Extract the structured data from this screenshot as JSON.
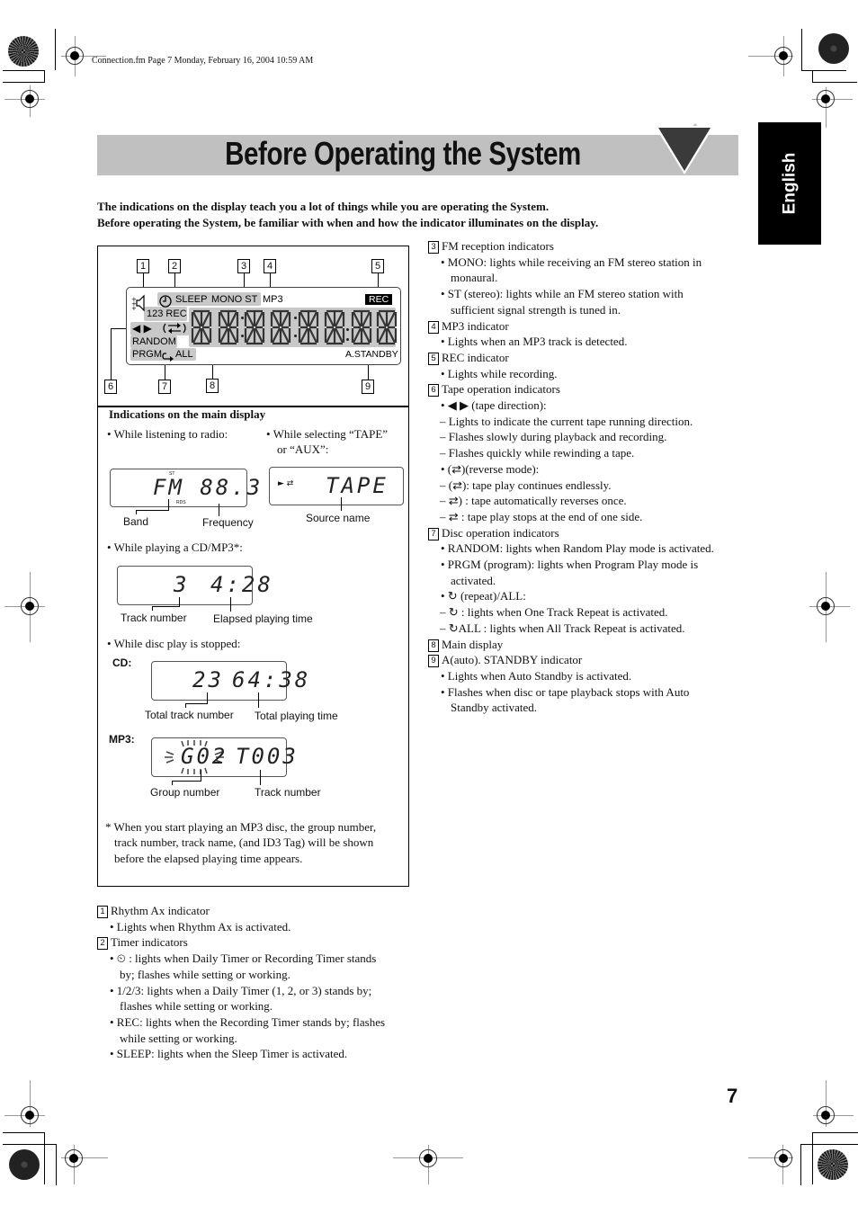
{
  "header": {
    "file_info": "Connection.fm  Page 7  Monday, February 16, 2004  10:59 AM"
  },
  "title": "Before Operating the System",
  "language_tab": "English",
  "intro": [
    "The indications on the display teach you a lot of things while you are operating the System.",
    "Before operating the System, be familiar with when and how the indicator illuminates on the display."
  ],
  "display_diagram": {
    "callouts": [
      "1",
      "2",
      "3",
      "4",
      "5",
      "6",
      "7",
      "8",
      "9"
    ],
    "labels": {
      "sleep": "SLEEP",
      "mono_st": "MONO ST",
      "mp3": "MP3",
      "rec": "REC",
      "timer_rec": "123 REC",
      "tape_dir": "◀ ▶",
      "random": "RANDOM",
      "prgm_all": "PRGM",
      "all": "ALL",
      "standby": "A.STANDBY"
    },
    "icons": [
      "rhythm-ax-icon",
      "timer-clock-icon",
      "tape-reverse-icon",
      "repeat-icon"
    ]
  },
  "main_display": {
    "heading": "Indications on the main display",
    "radio": {
      "bullet": "• While listening to radio:",
      "st": "ST",
      "rds": "RDS",
      "readout": "FM  88.3",
      "caption_band": "Band",
      "caption_freq": "Frequency"
    },
    "tape": {
      "bullet_line1": "• While selecting “TAPE”",
      "bullet_line2": "or “AUX”:",
      "indicator": "► ⇄",
      "readout": "TAPE",
      "caption": "Source name"
    },
    "cd_play": {
      "bullet": "• While playing a CD/MP3*:",
      "track": "3",
      "time": "4:28",
      "caption_track": "Track number",
      "caption_time": "Elapsed playing time"
    },
    "stopped": {
      "bullet": "• While disc play is stopped:",
      "cd_label": "CD:",
      "cd_tracks": "23",
      "cd_time": "64:38",
      "caption_total_tracks": "Total track number",
      "caption_total_time": "Total playing time",
      "mp3_label": "MP3:",
      "mp3_group": "G02",
      "mp3_track": "T003",
      "caption_group": "Group number",
      "caption_track": "Track number"
    },
    "footnote": [
      "* When you start playing an MP3 disc, the group number,",
      "track number, track name, (and ID3 Tag) will be shown",
      "before the elapsed playing time appears."
    ]
  },
  "left_list": [
    {
      "type": "head",
      "num": "1",
      "text": "Rhythm Ax indicator"
    },
    {
      "type": "b1",
      "text": "• Lights when Rhythm Ax is activated."
    },
    {
      "type": "head",
      "num": "2",
      "text": "Timer indicators"
    },
    {
      "type": "b1",
      "text": "•  ⏲ : lights when Daily Timer or Recording Timer stands"
    },
    {
      "type": "b1c",
      "text": "by; flashes while setting or working."
    },
    {
      "type": "b1",
      "text": "• 1/2/3: lights when a Daily Timer (1, 2, or 3) stands by;"
    },
    {
      "type": "b1c",
      "text": "flashes while setting or working."
    },
    {
      "type": "b1",
      "text": "• REC: lights when the Recording Timer stands by; flashes"
    },
    {
      "type": "b1c",
      "text": "while setting or working."
    },
    {
      "type": "b1",
      "text": "• SLEEP: lights when the Sleep Timer is activated."
    }
  ],
  "right_list": [
    {
      "type": "head",
      "num": "3",
      "text": "FM reception indicators"
    },
    {
      "type": "b1",
      "text": "• MONO: lights while receiving an FM stereo station in"
    },
    {
      "type": "b1c",
      "text": "monaural."
    },
    {
      "type": "b1",
      "text": "• ST (stereo): lights while an FM stereo station with"
    },
    {
      "type": "b1c",
      "text": "sufficient signal strength is tuned in."
    },
    {
      "type": "head",
      "num": "4",
      "text": "MP3 indicator"
    },
    {
      "type": "b1",
      "text": "• Lights when an MP3 track is detected."
    },
    {
      "type": "head",
      "num": "5",
      "text": "REC indicator"
    },
    {
      "type": "b1",
      "text": "• Lights while recording."
    },
    {
      "type": "head",
      "num": "6",
      "text": "Tape operation indicators"
    },
    {
      "type": "b1",
      "text": "• ◀ ▶ (tape direction):"
    },
    {
      "type": "b2",
      "text": "– Lights to indicate the current tape running direction."
    },
    {
      "type": "b2",
      "text": "– Flashes slowly during playback and recording."
    },
    {
      "type": "b2",
      "text": "– Flashes quickly while rewinding a tape."
    },
    {
      "type": "b1",
      "text": "• (⇄)(reverse mode):"
    },
    {
      "type": "b2",
      "text": "– (⇄): tape play continues endlessly."
    },
    {
      "type": "b2",
      "text": "–  ⇄)  : tape automatically reverses once."
    },
    {
      "type": "b2",
      "text": "–   ⇄   : tape play stops at the end of one side."
    },
    {
      "type": "head",
      "num": "7",
      "text": "Disc operation indicators"
    },
    {
      "type": "b1",
      "text": "• RANDOM: lights when Random Play mode is activated."
    },
    {
      "type": "b1",
      "text": "• PRGM (program): lights when Program Play mode is"
    },
    {
      "type": "b1c",
      "text": "activated."
    },
    {
      "type": "b1",
      "text": "• ↻ (repeat)/ALL:"
    },
    {
      "type": "b2",
      "text": "– ↻ : lights when One Track Repeat is activated."
    },
    {
      "type": "b2",
      "text": "– ↻ALL : lights when All Track Repeat is activated."
    },
    {
      "type": "head",
      "num": "8",
      "text": "Main display"
    },
    {
      "type": "head",
      "num": "9",
      "text": "A(auto). STANDBY indicator"
    },
    {
      "type": "b1",
      "text": "• Lights when Auto Standby is activated."
    },
    {
      "type": "b1",
      "text": "• Flashes when disc or tape playback stops with Auto"
    },
    {
      "type": "b1c",
      "text": "Standby activated."
    }
  ],
  "page_number": "7"
}
